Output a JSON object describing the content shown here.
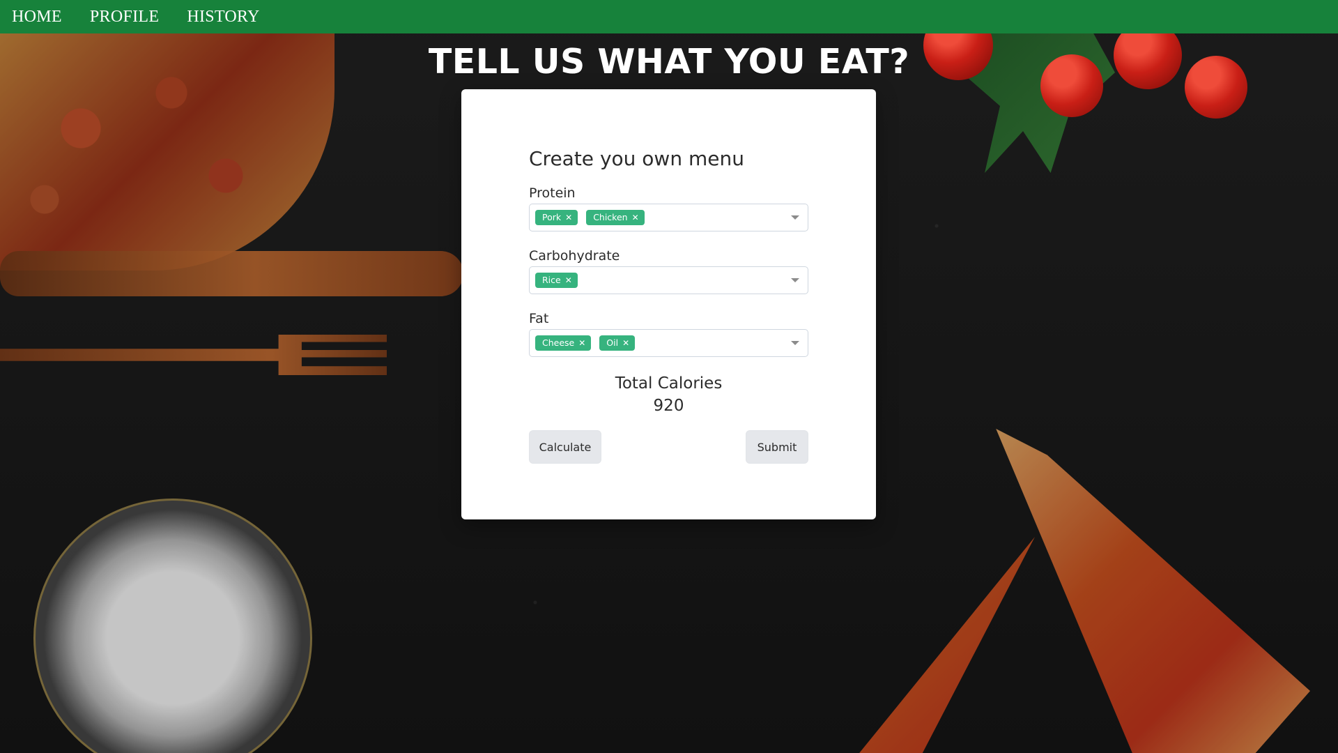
{
  "topbar": {
    "links": [
      {
        "label": "HOME"
      },
      {
        "label": "PROFILE"
      },
      {
        "label": "HISTORY"
      }
    ]
  },
  "page": {
    "heading": "TELL US WHAT YOU EAT?"
  },
  "form": {
    "title": "Create you own menu",
    "protein": {
      "label": "Protein",
      "tags": [
        "Pork",
        "Chicken"
      ]
    },
    "carbohydrate": {
      "label": "Carbohydrate",
      "tags": [
        "Rice"
      ]
    },
    "fat": {
      "label": "Fat",
      "tags": [
        "Cheese",
        "Oil"
      ]
    },
    "total_calories": {
      "label": "Total Calories",
      "value": "920"
    },
    "buttons": {
      "calculate": "Calculate",
      "submit": "Submit"
    }
  },
  "colors": {
    "nav_green": "#17823b",
    "tag_green": "#36b37e",
    "card_bg": "#ffffff"
  },
  "icons": {
    "tag_remove": "close-icon",
    "select_caret": "chevron-down-icon"
  }
}
